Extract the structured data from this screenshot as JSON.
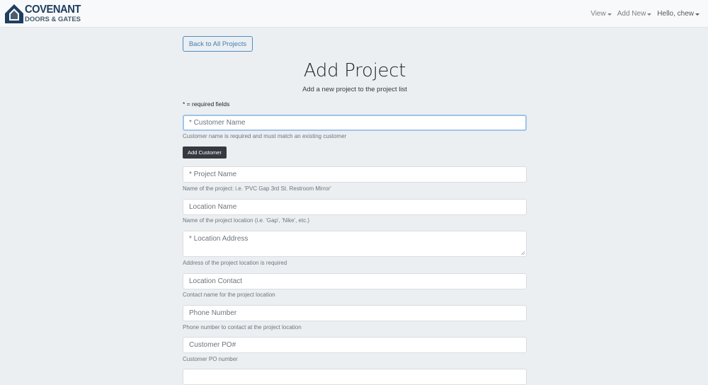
{
  "brand": {
    "line1": "COVENANT",
    "line2": "DOORS & GATES"
  },
  "nav": {
    "view": "View",
    "add_new": "Add New",
    "user": "Hello, chew"
  },
  "back_button": "Back to All Projects",
  "page": {
    "title": "Add Project",
    "subtitle": "Add a new project to the project list",
    "required_note": "* = required fields"
  },
  "form": {
    "customer_name": {
      "placeholder": "* Customer Name",
      "help": "Customer name is required and must match an existing customer"
    },
    "add_customer_button": "Add Customer",
    "project_name": {
      "placeholder": "* Project Name",
      "help": "Name of the project: i.e. 'PVC Gap 3rd St. Restroom Mirror'"
    },
    "location_name": {
      "placeholder": "Location Name",
      "help": "Name of the project location (i.e. 'Gap', 'Nike', etc.)"
    },
    "location_address": {
      "placeholder": "* Location Address",
      "help": "Address of the project location is required"
    },
    "location_contact": {
      "placeholder": "Location Contact",
      "help": "Contact name for the project location"
    },
    "phone_number": {
      "placeholder": "Phone Number",
      "help": "Phone number to contact at the project location"
    },
    "customer_po": {
      "placeholder": "Customer PO#",
      "help": "Customer PO number"
    }
  },
  "colors": {
    "brand_navy": "#1f3e60",
    "link_blue": "#3f7fb8",
    "focus_ring": "#9ec5ea",
    "dark_button": "#343a40",
    "page_bg": "#eceff1"
  },
  "icons": {
    "logo": "covenant-logo-icon",
    "dropdown": "caret-down-icon",
    "resize": "resize-grip-icon"
  }
}
